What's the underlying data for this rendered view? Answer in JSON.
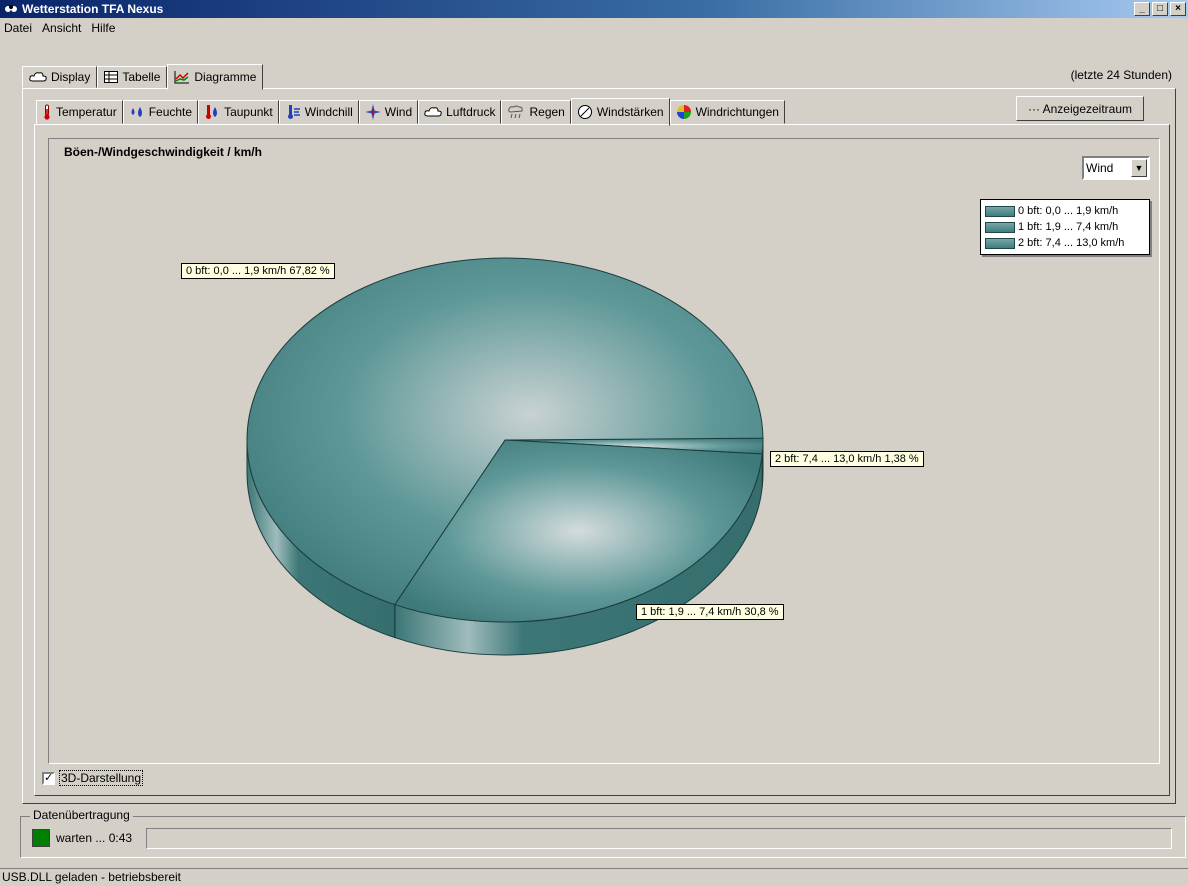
{
  "window": {
    "title": "Wetterstation TFA Nexus",
    "minimize": "_",
    "maximize": "□",
    "close": "×"
  },
  "menu": {
    "items": [
      {
        "label": "Datei"
      },
      {
        "label": "Ansicht"
      },
      {
        "label": "Hilfe"
      }
    ]
  },
  "outer_tabs": [
    {
      "label": "Display",
      "icon": "cloud-icon"
    },
    {
      "label": "Tabelle",
      "icon": "table-icon"
    },
    {
      "label": "Diagramme",
      "icon": "chart-icon",
      "active": true
    }
  ],
  "range_label": "(letzte 24 Stunden)",
  "inner_tabs": [
    {
      "label": "Temperatur",
      "icon": "thermometer-icon"
    },
    {
      "label": "Feuchte",
      "icon": "droplets-icon"
    },
    {
      "label": "Taupunkt",
      "icon": "dewpoint-icon"
    },
    {
      "label": "Windchill",
      "icon": "windchill-icon"
    },
    {
      "label": "Wind",
      "icon": "compass-icon"
    },
    {
      "label": "Luftdruck",
      "icon": "cloud-icon"
    },
    {
      "label": "Regen",
      "icon": "rain-icon"
    },
    {
      "label": "Windstärken",
      "icon": "gauge-icon",
      "active": true
    },
    {
      "label": "Windrichtungen",
      "icon": "color-wheel-icon"
    }
  ],
  "range_button": "··· Anzeigezeitraum",
  "chart": {
    "title": "Böen-/Windgeschwindigkeit / km/h",
    "selector_value": "Wind"
  },
  "chart_data": {
    "type": "pie",
    "title": "Böen-/Windgeschwindigkeit / km/h",
    "slices": [
      {
        "label": "0 bft: 0,0 ... 1,9 km/h",
        "value": 67.82,
        "callout": "0 bft: 0,0 ... 1,9 km/h 67,82 %"
      },
      {
        "label": "1 bft: 1,9 ... 7,4 km/h",
        "value": 30.8,
        "callout": "1 bft: 1,9 ... 7,4 km/h 30,8 %"
      },
      {
        "label": "2 bft: 7,4 ... 13,0 km/h",
        "value": 1.38,
        "callout": "2 bft: 7,4 ... 13,0 km/h 1,38 %"
      }
    ],
    "legend_position": "top-right",
    "three_d": true,
    "color": "#4f8a8a"
  },
  "options": {
    "three_d_label": "3D-Darstellung",
    "three_d_checked": "✓"
  },
  "transfer": {
    "group_label": "Datenübertragung",
    "status": "warten ... 0:43",
    "led_color": "#007f00"
  },
  "statusbar": "USB.DLL geladen - betriebsbereit"
}
